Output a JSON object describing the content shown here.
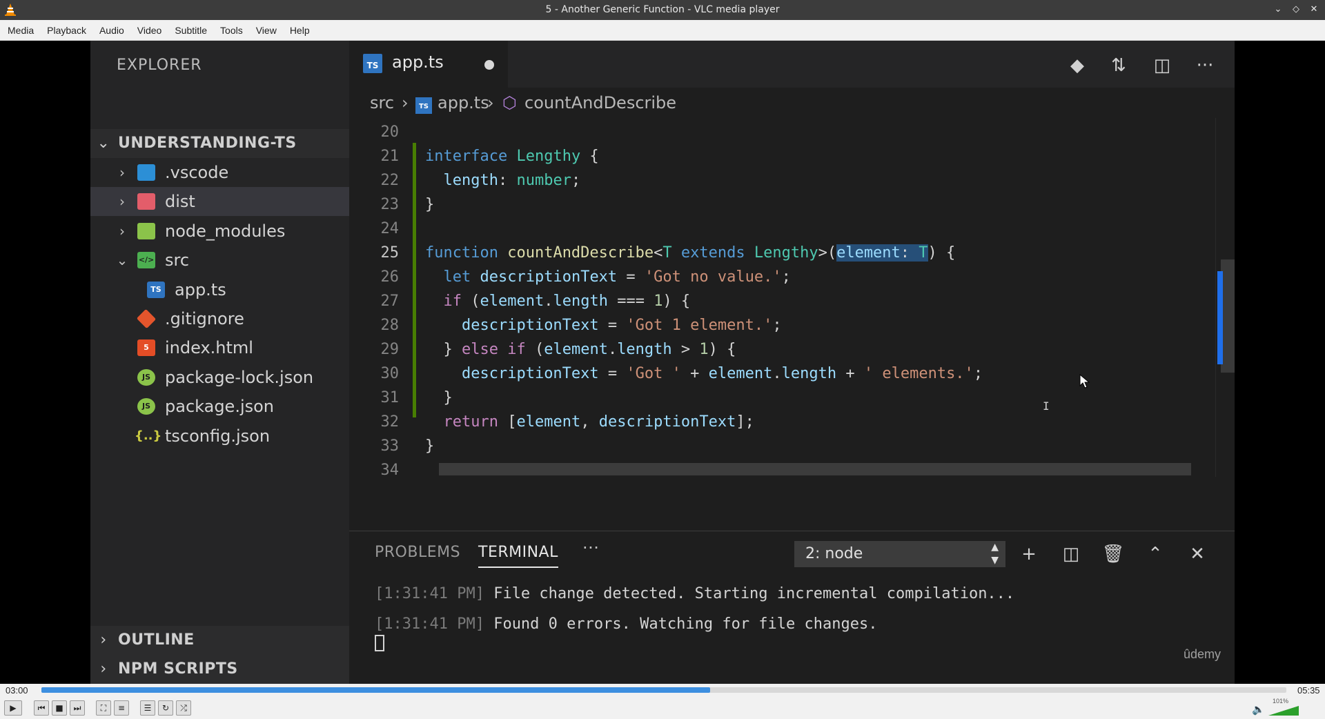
{
  "window": {
    "title": "5 - Another Generic Function - VLC media player"
  },
  "menubar": [
    "Media",
    "Playback",
    "Audio",
    "Video",
    "Subtitle",
    "Tools",
    "View",
    "Help"
  ],
  "sidebar": {
    "explorer_title": "EXPLORER",
    "project": "UNDERSTANDING-TS",
    "items": [
      {
        "label": ".vscode",
        "icon": "vscode-folder-icon",
        "color": "#2c8fd6"
      },
      {
        "label": "dist",
        "icon": "folder-red-icon",
        "color": "#e35d6a"
      },
      {
        "label": "node_modules",
        "icon": "folder-green-icon",
        "color": "#8bc34a"
      },
      {
        "label": "src",
        "icon": "folder-src-icon",
        "color": "#4caf50"
      },
      {
        "label": "app.ts",
        "icon": "typescript-icon",
        "color": "#2f74c0"
      },
      {
        "label": ".gitignore",
        "icon": "git-icon",
        "color": "#e4552c"
      },
      {
        "label": "index.html",
        "icon": "html5-icon",
        "color": "#e44d26"
      },
      {
        "label": "package-lock.json",
        "icon": "nodejs-icon",
        "color": "#8bc34a"
      },
      {
        "label": "package.json",
        "icon": "nodejs-icon",
        "color": "#8bc34a"
      },
      {
        "label": "tsconfig.json",
        "icon": "json-icon",
        "color": "#cbcb41"
      }
    ],
    "outline": "OUTLINE",
    "npm_scripts": "NPM SCRIPTS"
  },
  "editor": {
    "tab": {
      "label": "app.ts",
      "badge": "TS"
    },
    "breadcrumb": {
      "folder": "src",
      "file": "app.ts",
      "symbol": "countAndDescribe"
    },
    "line_numbers": [
      "20",
      "21",
      "22",
      "23",
      "24",
      "25",
      "26",
      "27",
      "28",
      "29",
      "30",
      "31",
      "32",
      "33",
      "34"
    ],
    "code": {
      "l21": {
        "kw": "interface",
        "name": "Lengthy",
        "rest": " {"
      },
      "l22": {
        "prop": "length",
        "colon": ": ",
        "type": "number",
        "end": ";"
      },
      "l23": "}",
      "l25": {
        "kw": "function",
        "fn": "countAndDescribe",
        "lt": "<",
        "tparam": "T",
        "extends": "extends",
        "constraint": "Lengthy",
        "gt": ">(",
        "param": "element",
        "colon": ": ",
        "ptype": "T",
        "close": ")",
        "brace": " {"
      },
      "l26": {
        "kw": "let",
        "var": "descriptionText",
        "eq": " = ",
        "str": "'Got no value.'",
        "end": ";"
      },
      "l27": {
        "kw": "if",
        "open": " (",
        "obj": "element",
        "dot": ".",
        "prop": "length",
        "op": " === ",
        "num": "1",
        "close": ") {"
      },
      "l28": {
        "var": "descriptionText",
        "eq": " = ",
        "str": "'Got 1 element.'",
        "end": ";"
      },
      "l29": {
        "pre": "} ",
        "kw": "else if",
        "open": " (",
        "obj": "element",
        "dot": ".",
        "prop": "length",
        "op": " > ",
        "num": "1",
        "close": ") {"
      },
      "l30": {
        "var": "descriptionText",
        "eq": " = ",
        "str1": "'Got '",
        "plus1": " + ",
        "obj": "element",
        "dot": ".",
        "prop": "length",
        "plus2": " + ",
        "str2": "' elements.'",
        "end": ";"
      },
      "l31": "}",
      "l32": {
        "kw": "return",
        "open": " [",
        "a": "element",
        "comma": ", ",
        "b": "descriptionText",
        "end": "];"
      },
      "l33": "}"
    }
  },
  "panel": {
    "tab_problems": "PROBLEMS",
    "tab_terminal": "TERMINAL",
    "more": "···",
    "terminal_select": "2: node",
    "lines": [
      {
        "ts": "[1:31:41 PM]",
        "msg": " File change detected. Starting incremental compilation..."
      },
      {
        "ts": "[1:31:41 PM]",
        "msg": " Found 0 errors. Watching for file changes."
      }
    ],
    "watermark": "ûdemy"
  },
  "player": {
    "elapsed": "03:00",
    "total": "05:35",
    "progress": 0.537,
    "volume_label": "101%",
    "volume": 1.01,
    "accent": "#3d8fe0"
  }
}
